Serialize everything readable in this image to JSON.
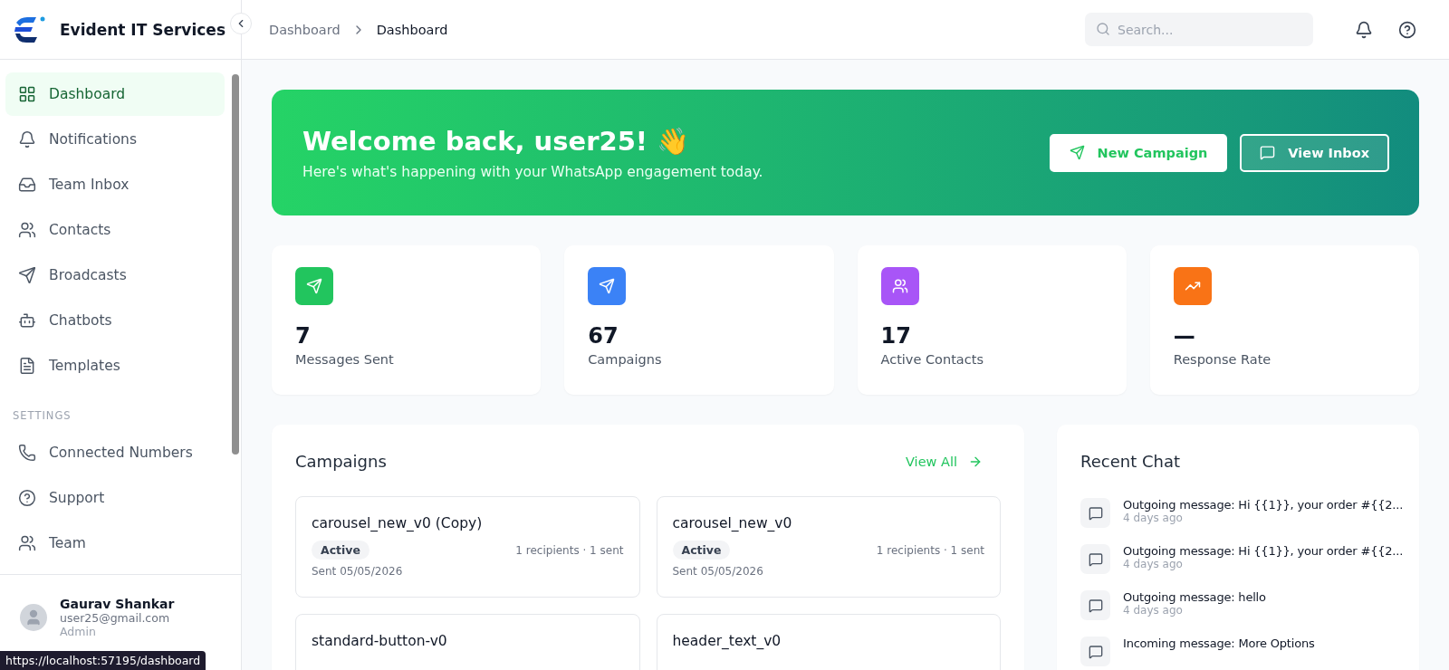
{
  "brand": {
    "name": "Evident IT Services"
  },
  "sidebar": {
    "items": [
      {
        "label": "Dashboard",
        "kind": "dashboard",
        "selected": true
      },
      {
        "label": "Notifications",
        "kind": "bell",
        "selected": false
      },
      {
        "label": "Team Inbox",
        "kind": "inbox",
        "selected": false
      },
      {
        "label": "Contacts",
        "kind": "users",
        "selected": false
      },
      {
        "label": "Broadcasts",
        "kind": "send",
        "selected": false
      },
      {
        "label": "Chatbots",
        "kind": "bot",
        "selected": false
      },
      {
        "label": "Templates",
        "kind": "file",
        "selected": false
      }
    ],
    "section_title": "SETTINGS",
    "settings_items": [
      {
        "label": "Connected Numbers",
        "kind": "phone",
        "selected": false
      },
      {
        "label": "Support",
        "kind": "help",
        "selected": false
      },
      {
        "label": "Team",
        "kind": "users",
        "selected": false
      }
    ]
  },
  "user": {
    "name": "Gaurav Shankar",
    "email": "user25@gmail.com",
    "role": "Admin"
  },
  "status_url": "https://localhost:57195/dashboard",
  "breadcrumb": [
    "Dashboard",
    "Dashboard"
  ],
  "search": {
    "placeholder": "Search..."
  },
  "hero": {
    "title": "Welcome back, user25! 👋",
    "subtitle": "Here's what's happening with your WhatsApp engagement today.",
    "buttons": [
      {
        "label": "New Campaign",
        "kind": "primary"
      },
      {
        "label": "View Inbox",
        "kind": "outline"
      }
    ]
  },
  "stats": [
    {
      "value": "7",
      "label": "Messages Sent",
      "kind": "send",
      "color": "#22c55e"
    },
    {
      "value": "67",
      "label": "Campaigns",
      "kind": "send",
      "color": "#3b82f6"
    },
    {
      "value": "17",
      "label": "Active Contacts",
      "kind": "users",
      "color": "#a855f7"
    },
    {
      "value": "—",
      "label": "Response Rate",
      "kind": "trend",
      "color": "#f97316"
    }
  ],
  "campaigns": {
    "title": "Campaigns",
    "view_all": "View All",
    "items": [
      {
        "name": "carousel_new_v0 (Copy)",
        "status": "Active",
        "meta": "1 recipients · 1 sent",
        "date": "Sent 05/05/2026"
      },
      {
        "name": "carousel_new_v0",
        "status": "Active",
        "meta": "1 recipients · 1 sent",
        "date": "Sent 05/05/2026"
      },
      {
        "name": "standard-button-v0"
      },
      {
        "name": "header_text_v0"
      }
    ]
  },
  "recent_chat": {
    "title": "Recent Chat",
    "items": [
      {
        "text": "Outgoing message: Hi {{1}}, your order #{{2...",
        "time": "4 days ago"
      },
      {
        "text": "Outgoing message: Hi {{1}}, your order #{{2...",
        "time": "4 days ago"
      },
      {
        "text": "Outgoing message: hello",
        "time": "4 days ago"
      },
      {
        "text": "Incoming message: More Options"
      }
    ]
  }
}
